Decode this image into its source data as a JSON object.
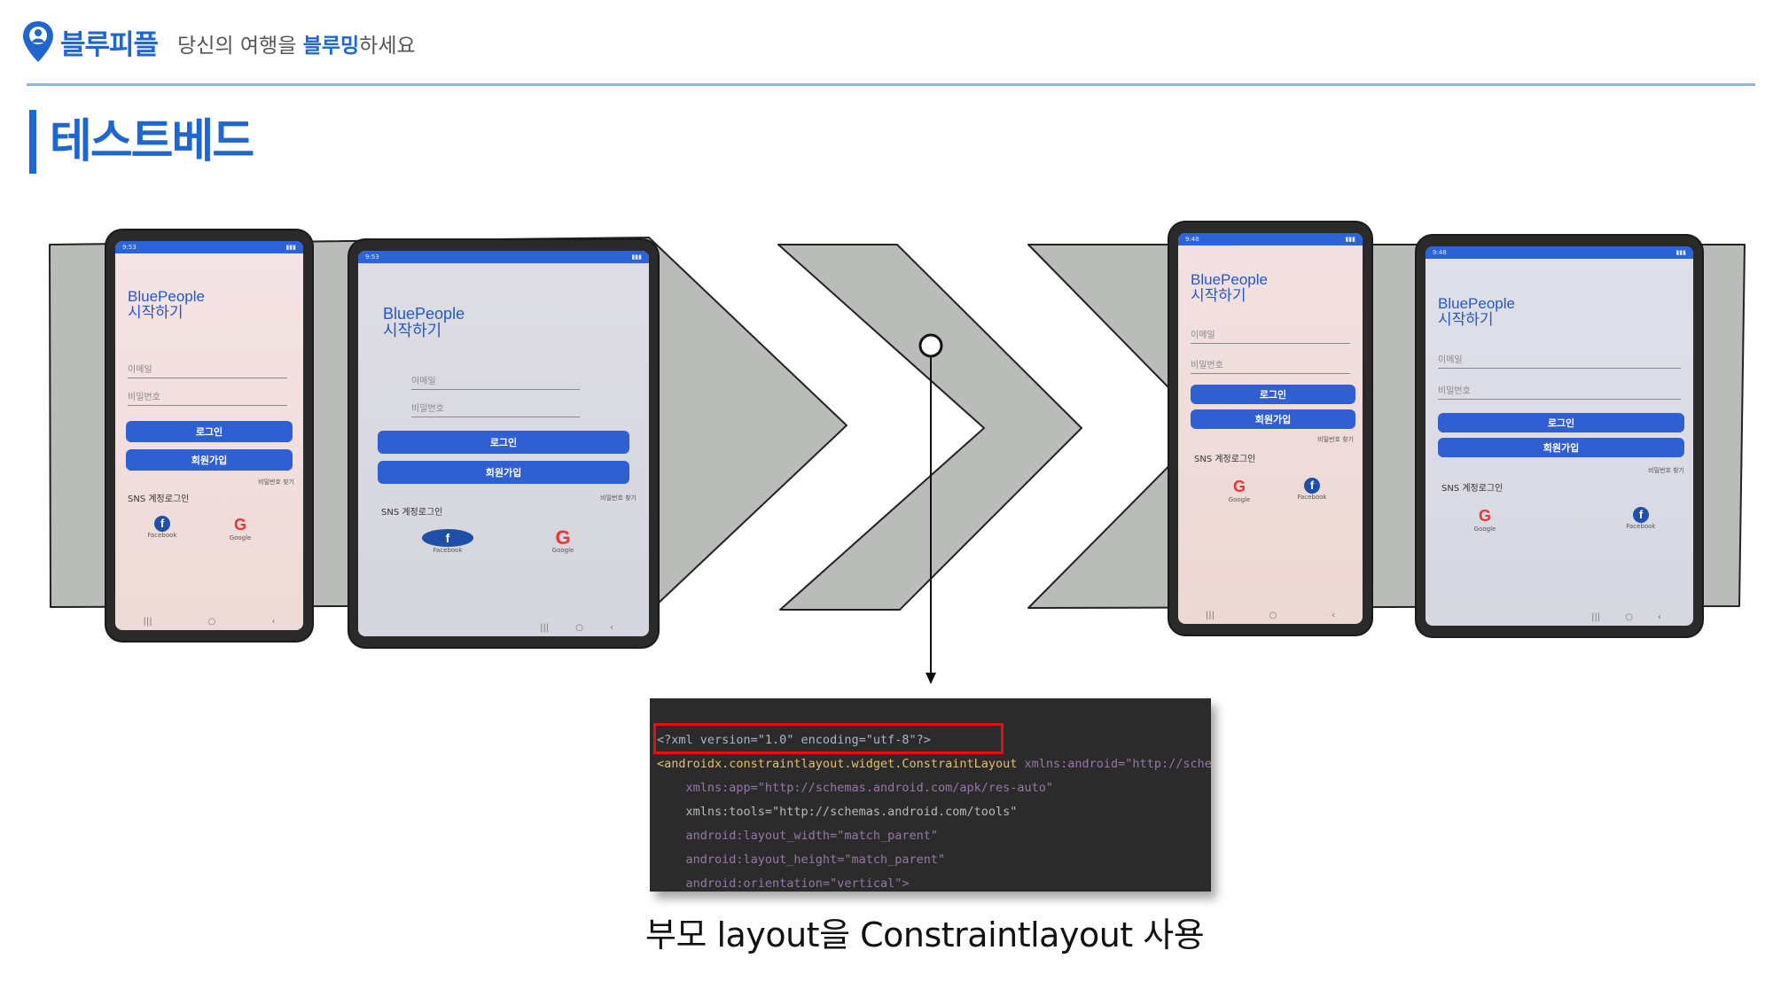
{
  "header": {
    "brand": "블루피플",
    "slogan_prefix": "당신의 여행을 ",
    "slogan_highlight": "블루밍",
    "slogan_suffix": "하세요"
  },
  "page_title": "테스트베드",
  "phones": [
    {
      "status": "9:53",
      "app_title_line1": "BluePeople",
      "app_title_line2": "시작하기",
      "email_placeholder": "이메일",
      "password_placeholder": "비밀번호",
      "login_label": "로그인",
      "signup_label": "회원가입",
      "find_password": "비밀번호 찾기",
      "sns_label": "SNS 계정로그인",
      "sns1": "Facebook",
      "sns2": "Google"
    },
    {
      "status": "9:53",
      "app_title_line1": "BluePeople",
      "app_title_line2": "시작하기",
      "email_placeholder": "이메일",
      "password_placeholder": "비밀번호",
      "login_label": "로그인",
      "signup_label": "회원가입",
      "find_password": "비밀번호 찾기",
      "sns_label": "SNS 계정로그인",
      "sns1": "Facebook",
      "sns2": "Google"
    },
    {
      "status": "9:48",
      "app_title_line1": "BluePeople",
      "app_title_line2": "시작하기",
      "email_placeholder": "이메일",
      "password_placeholder": "비밀번호",
      "login_label": "로그인",
      "signup_label": "회원가입",
      "find_password": "비밀번호 찾기",
      "sns_label": "SNS 계정로그인",
      "sns1": "Google",
      "sns2": "Facebook"
    },
    {
      "status": "9:48",
      "app_title_line1": "BluePeople",
      "app_title_line2": "시작하기",
      "email_placeholder": "이메일",
      "password_placeholder": "비밀번호",
      "login_label": "로그인",
      "signup_label": "회원가입",
      "find_password": "비밀번호 찾기",
      "sns_label": "SNS 계정로그인",
      "sns1": "Google",
      "sns2": "Facebook"
    }
  ],
  "code": {
    "line1": "<?xml version=\"1.0\" encoding=\"utf-8\"?>",
    "line2_tag": "<androidx.constraintlayout.widget.ConstraintLayout",
    "line2_rest": " xmlns:android=\"http://schemas",
    "line3": "    xmlns:app=\"http://schemas.android.com/apk/res-auto\"",
    "line4": "    xmlns:tools=\"http://schemas.android.com/tools\"",
    "line5": "    android:layout_width=\"match_parent\"",
    "line6": "    android:layout_height=\"match_parent\"",
    "line7": "    android:orientation=\"vertical\">"
  },
  "caption": "부모 layout을  Constraintlayout 사용",
  "colors": {
    "brand_blue": "#1f66d1",
    "band_gray": "#b9bcb8",
    "button_blue": "#2f5fd0",
    "highlight_red": "#e01010"
  }
}
